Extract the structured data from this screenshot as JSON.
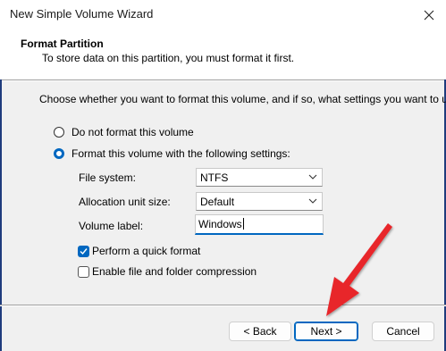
{
  "window": {
    "title": "New Simple Volume Wizard"
  },
  "header": {
    "title": "Format Partition",
    "subtitle": "To store data on this partition, you must format it first."
  },
  "instruction": "Choose whether you want to format this volume, and if so, what settings you want to use.",
  "options": {
    "no_format": {
      "label": "Do not format this volume",
      "selected": false
    },
    "format": {
      "label": "Format this volume with the following settings:",
      "selected": true
    }
  },
  "settings": {
    "file_system": {
      "label": "File system:",
      "value": "NTFS"
    },
    "allocation": {
      "label": "Allocation unit size:",
      "value": "Default"
    },
    "volume_label": {
      "label": "Volume label:",
      "value": "Windows"
    }
  },
  "checkboxes": {
    "quick_format": {
      "label": "Perform a quick format",
      "checked": true
    },
    "compression": {
      "label": "Enable file and folder compression",
      "checked": false
    }
  },
  "buttons": {
    "back": "< Back",
    "next": "Next >",
    "cancel": "Cancel"
  },
  "colors": {
    "accent": "#0067c0",
    "annotation_arrow": "#e8262c"
  }
}
